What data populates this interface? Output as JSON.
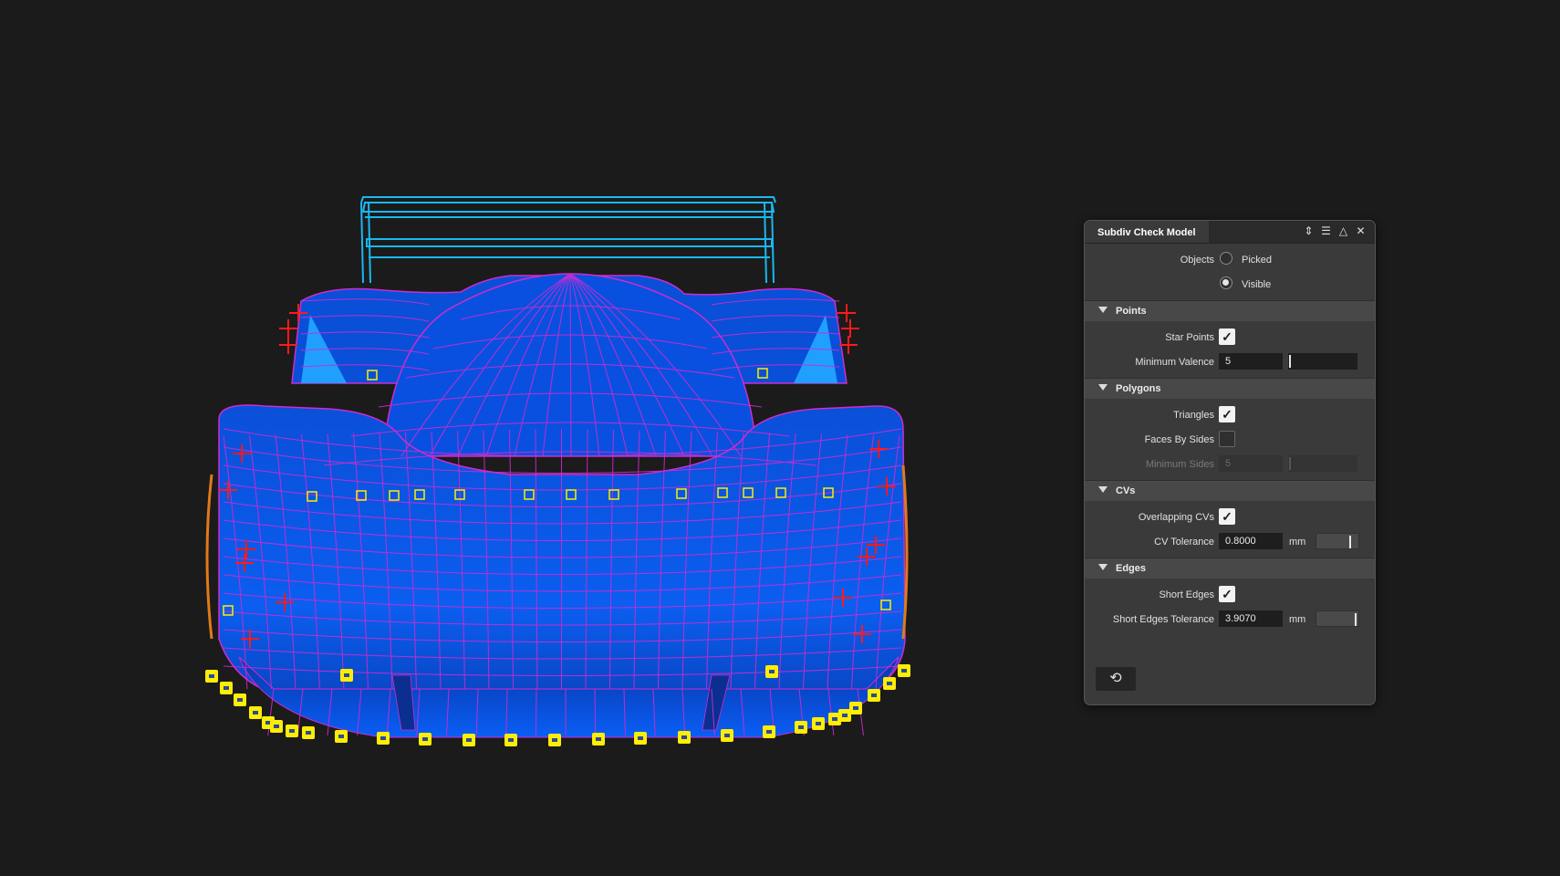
{
  "panel": {
    "title": "Subdiv Check Model",
    "title_icons": [
      "expand-icon",
      "menu-icon",
      "collapse-icon",
      "close-icon"
    ],
    "objects": {
      "label": "Objects",
      "options": [
        {
          "label": "Picked",
          "selected": false
        },
        {
          "label": "Visible",
          "selected": true
        }
      ]
    },
    "points": {
      "title": "Points",
      "star_points_label": "Star Points",
      "star_points_checked": true,
      "min_valence_label": "Minimum Valence",
      "min_valence_value": "5"
    },
    "polygons": {
      "title": "Polygons",
      "triangles_label": "Triangles",
      "triangles_checked": true,
      "faces_by_sides_label": "Faces By Sides",
      "faces_by_sides_checked": false,
      "min_sides_label": "Minimum Sides",
      "min_sides_value": "5"
    },
    "cvs": {
      "title": "CVs",
      "overlapping_label": "Overlapping CVs",
      "overlapping_checked": true,
      "tolerance_label": "CV Tolerance",
      "tolerance_value": "0.8000",
      "tolerance_unit": "mm"
    },
    "edges": {
      "title": "Edges",
      "short_edges_label": "Short Edges",
      "short_edges_checked": true,
      "tolerance_label": "Short Edges Tolerance",
      "tolerance_value": "3.9070",
      "tolerance_unit": "mm"
    },
    "reset_icon": "reset-icon"
  },
  "colors": {
    "background": "#1b1b1b",
    "body_fill": "#0a55e6",
    "wire_magenta": "#d02bd0",
    "wing_cyan": "#19b8f0",
    "star_point_red": "#ff1a1a",
    "marker_yellow": "#ffee00"
  }
}
